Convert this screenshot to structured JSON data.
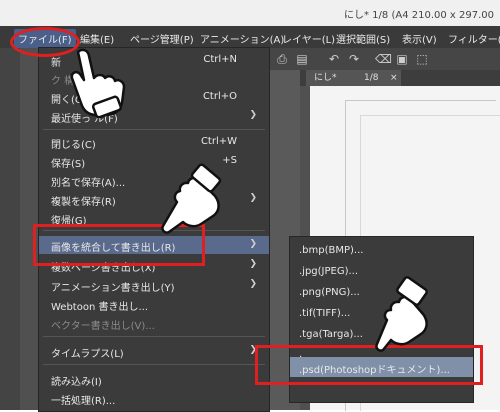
{
  "window": {
    "title": "にし* 1/8 (A4 210.00 x 297.00"
  },
  "menubar": {
    "items": [
      {
        "label": "ファイル(F)"
      },
      {
        "label": "編集(E)"
      },
      {
        "label": "ページ管理(P)"
      },
      {
        "label": "アニメーション(A)"
      },
      {
        "label": "レイヤー(L)"
      },
      {
        "label": "選択範囲(S)"
      },
      {
        "label": "表示(V)"
      },
      {
        "label": "フィルター(I)"
      }
    ]
  },
  "document_tab": {
    "name": "にし*",
    "page": "1/8",
    "close": "×"
  },
  "file_menu": {
    "items": [
      {
        "label": "新",
        "shortcut": "Ctrl+N"
      },
      {
        "label": "ク                    構成(B)",
        "shortcut": ""
      },
      {
        "label": "開く(O)",
        "shortcut": "Ctrl+O"
      },
      {
        "label": "最近使っ      ル(F)",
        "shortcut": ""
      },
      {
        "label": "閉じる(C)",
        "shortcut": "Ctrl+W"
      },
      {
        "label": "保存(S)",
        "shortcut": "+S"
      },
      {
        "label": "別名で保存(A)...",
        "shortcut": ""
      },
      {
        "label": "複製を保存(R)",
        "shortcut": ""
      },
      {
        "label": "復帰(G)",
        "shortcut": ""
      },
      {
        "label": "画像を統合して書き出し(R)",
        "shortcut": ""
      },
      {
        "label": "複数ページ書き出し(X)",
        "shortcut": ""
      },
      {
        "label": "アニメーション書き出し(Y)",
        "shortcut": ""
      },
      {
        "label": "Webtoon 書き出し...",
        "shortcut": ""
      },
      {
        "label": "ベクター書き出し(V)...",
        "shortcut": ""
      },
      {
        "label": "タイムラプス(L)",
        "shortcut": ""
      },
      {
        "label": "読み込み(I)",
        "shortcut": ""
      },
      {
        "label": "一括処理(R)...",
        "shortcut": ""
      }
    ]
  },
  "export_submenu": {
    "items": [
      {
        "label": ".bmp(BMP)..."
      },
      {
        "label": ".jpg(JPEG)..."
      },
      {
        "label": ".png(PNG)..."
      },
      {
        "label": ".tif(TIFF)..."
      },
      {
        "label": ".tga(Targa)..."
      },
      {
        "label": "."
      },
      {
        "label": ".psd(Photoshopドキュメント)..."
      }
    ]
  },
  "colors": {
    "menu_bg": "#3b3b3b",
    "highlight": "#5a6a8c",
    "annotation_red": "#e02020"
  },
  "icons": [
    "arrow-right-icon",
    "undo-icon",
    "redo-icon",
    "close-icon",
    "pointing-hand-icon"
  ]
}
